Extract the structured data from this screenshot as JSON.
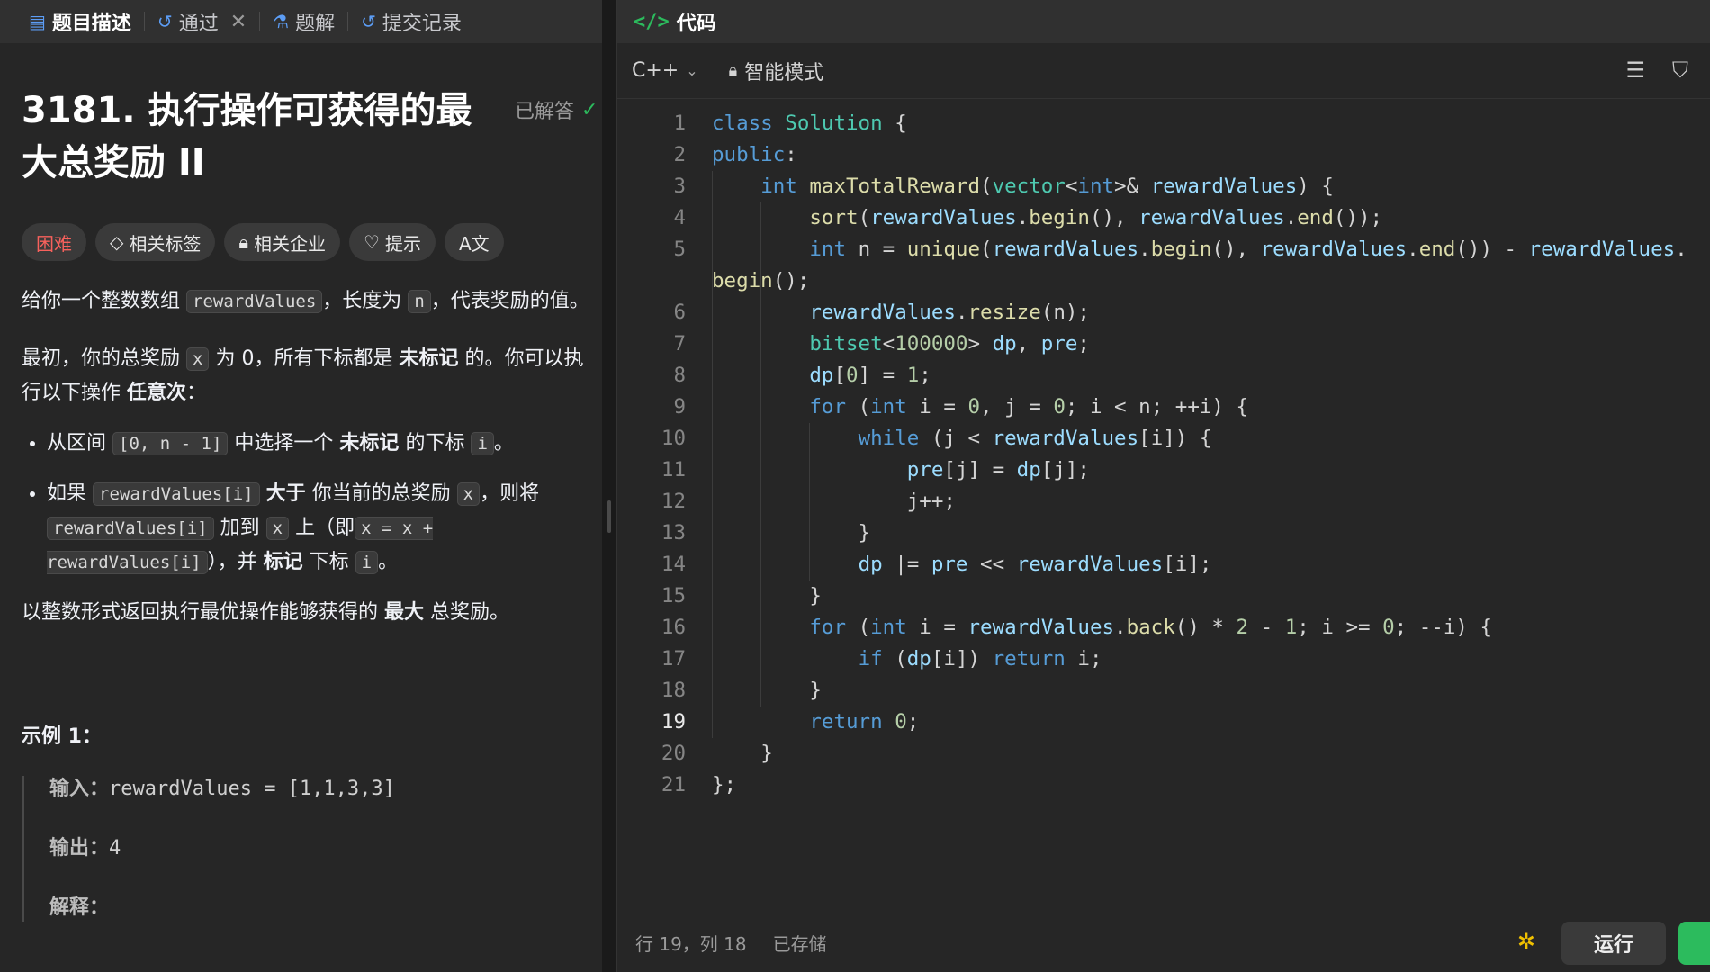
{
  "left_tabs": [
    {
      "label": "题目描述",
      "icon": "document-icon"
    },
    {
      "label": "通过",
      "icon": "history-icon"
    },
    {
      "label": "题解",
      "icon": "flask-icon"
    },
    {
      "label": "提交记录",
      "icon": "history-icon"
    }
  ],
  "problem": {
    "title": "3181. 执行操作可获得的最大总奖励 II",
    "status": "已解答",
    "tags": [
      "困难",
      "相关标签",
      "相关企业",
      "提示",
      "A文"
    ],
    "p1_a": "给你一个整数数组",
    "p1_code1": "rewardValues",
    "p1_b": "，长度为",
    "p1_code2": "n",
    "p1_c": "，代表奖励的值。",
    "p2_a": "最初，你的总奖励",
    "p2_code1": "x",
    "p2_b": "为 0，所有下标都是",
    "p2_bold1": "未标记",
    "p2_c": "的。你可以执行以下操作",
    "p2_bold2": "任意次",
    "p2_d": "：",
    "li1_a": "从区间",
    "li1_code": "[0, n - 1]",
    "li1_b": "中选择一个",
    "li1_bold": "未标记",
    "li1_c": "的下标",
    "li1_code2": "i",
    "li1_d": "。",
    "li2_a": "如果",
    "li2_code1": "rewardValues[i]",
    "li2_bold1": "大于",
    "li2_b": "你当前的总奖励",
    "li2_code2": "x",
    "li2_c": "，则将",
    "li2_code3": "rewardValues[i]",
    "li2_d": "加到",
    "li2_code4": "x",
    "li2_e": "上（即",
    "li2_code5": "x = x + rewardValues[i]",
    "li2_f": "），并",
    "li2_bold2": "标记",
    "li2_g": "下标",
    "li2_code6": "i",
    "li2_h": "。",
    "p3_a": "以整数形式返回执行最优操作能够获得的",
    "p3_bold": "最大",
    "p3_b": "总奖励。",
    "example_title": "示例 1：",
    "example": {
      "input_label": "输入：",
      "input_value": "rewardValues = [1,1,3,3]",
      "output_label": "输出：",
      "output_value": "4",
      "explain_label": "解释："
    }
  },
  "editor": {
    "header_title": "代码",
    "language": "C++",
    "mode": "智能模式",
    "status_position": "行 19，列 18",
    "status_saved": "已存储",
    "run_label": "运行",
    "current_line": 19,
    "lines": [
      "class Solution {",
      "public:",
      "    int maxTotalReward(vector<int>& rewardValues) {",
      "        sort(rewardValues.begin(), rewardValues.end());",
      "        int n = unique(rewardValues.begin(), rewardValues.end()) - rewardValues.",
      "begin();",
      "        rewardValues.resize(n);",
      "        bitset<100000> dp, pre;",
      "        dp[0] = 1;",
      "        for (int i = 0, j = 0; i < n; ++i) {",
      "            while (j < rewardValues[i]) {",
      "                pre[j] = dp[j];",
      "                j++;",
      "            }",
      "            dp |= pre << rewardValues[i];",
      "        }",
      "        for (int i = rewardValues.back() * 2 - 1; i >= 0; --i) {",
      "            if (dp[i]) return i;",
      "        }",
      "        return 0;",
      "    }",
      "};"
    ],
    "line_numbers": [
      "1",
      "2",
      "3",
      "4",
      "5",
      "",
      "6",
      "7",
      "8",
      "9",
      "10",
      "11",
      "12",
      "13",
      "14",
      "15",
      "16",
      "17",
      "18",
      "19",
      "20",
      "21"
    ]
  }
}
